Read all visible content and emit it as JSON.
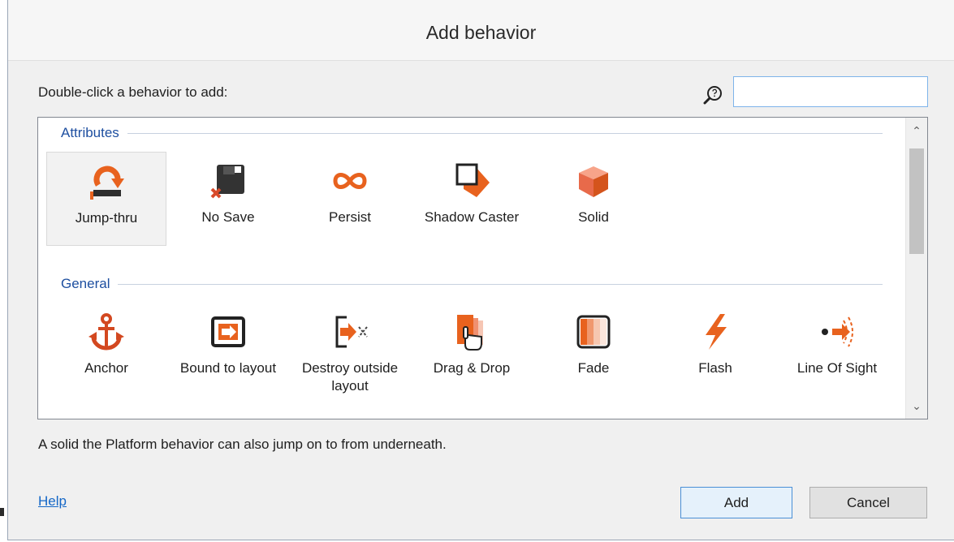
{
  "dialog": {
    "title": "Add behavior"
  },
  "prompt": "Double-click a behavior to add:",
  "search": {
    "value": "",
    "placeholder": ""
  },
  "categories": [
    {
      "name": "Attributes",
      "items": [
        {
          "label": "Jump-thru",
          "icon": "jump-thru-icon",
          "selected": true
        },
        {
          "label": "No Save",
          "icon": "no-save-icon"
        },
        {
          "label": "Persist",
          "icon": "persist-icon"
        },
        {
          "label": "Shadow Caster",
          "icon": "shadow-caster-icon"
        },
        {
          "label": "Solid",
          "icon": "solid-icon"
        }
      ]
    },
    {
      "name": "General",
      "items": [
        {
          "label": "Anchor",
          "icon": "anchor-icon"
        },
        {
          "label": "Bound to layout",
          "icon": "bound-to-layout-icon"
        },
        {
          "label": "Destroy outside layout",
          "icon": "destroy-outside-layout-icon"
        },
        {
          "label": "Drag & Drop",
          "icon": "drag-and-drop-icon"
        },
        {
          "label": "Fade",
          "icon": "fade-icon"
        },
        {
          "label": "Flash",
          "icon": "flash-icon"
        },
        {
          "label": "Line Of Sight",
          "icon": "line-of-sight-icon"
        }
      ]
    }
  ],
  "description": "A solid the Platform behavior can also jump on to from underneath.",
  "help_label": "Help",
  "buttons": {
    "add": "Add",
    "cancel": "Cancel"
  },
  "colors": {
    "icon_orange": "#e8621e",
    "icon_dark": "#3a3a3a",
    "link": "#1467c7",
    "accent_border": "#7eb4ea"
  }
}
